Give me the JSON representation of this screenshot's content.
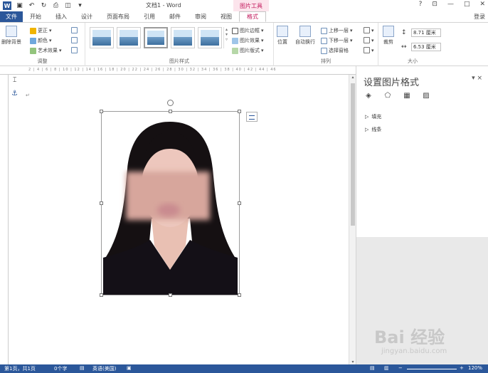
{
  "titlebar": {
    "doc_title": "文档1 - Word",
    "tools_label": "图片工具",
    "help": "?",
    "minimize": "—",
    "restore": "□",
    "close": "✕"
  },
  "tabs": [
    "开始",
    "插入",
    "设计",
    "页面布局",
    "引用",
    "邮件",
    "审阅",
    "视图"
  ],
  "file_tab": "文件",
  "active_tab": "格式",
  "login": "登录",
  "ribbon": {
    "remove_bg": "删除背景",
    "adjust": {
      "label": "调整",
      "correct": "更正",
      "color": "颜色",
      "art_effect": "艺术效果"
    },
    "styles": {
      "label": "图片样式",
      "border": "图片边框",
      "effect": "图片效果",
      "layout": "图片版式"
    },
    "arrange": {
      "label": "排列",
      "position": "位置",
      "wrap": "自动换行",
      "forward": "上移一层",
      "backward": "下移一层",
      "select_pane": "选择窗格"
    },
    "size": {
      "label": "大小",
      "crop": "裁剪",
      "height": "8.71 厘米",
      "width": "6.53 厘米"
    }
  },
  "ruler_text": "2 | 4 | 6 | 8 | 10 | 12 | 14 | 16 | 18 | 20 | 22 | 24 | 26 | 28 | 30 | 32 | 34 | 36 | 38 | 40 | 42 | 44 | 46",
  "pane": {
    "title": "设置图片格式",
    "close": "×",
    "sections": [
      "填充",
      "线条"
    ]
  },
  "status": {
    "page": "第1页，共1页",
    "words": "0个字",
    "lang": "英语(美国)",
    "zoom": "120%"
  },
  "watermark": {
    "main": "Bai 经验",
    "sub": "jingyan.baidu.com"
  },
  "colors": {
    "word_blue": "#2b579a",
    "tools_pink": "#c2185b"
  }
}
